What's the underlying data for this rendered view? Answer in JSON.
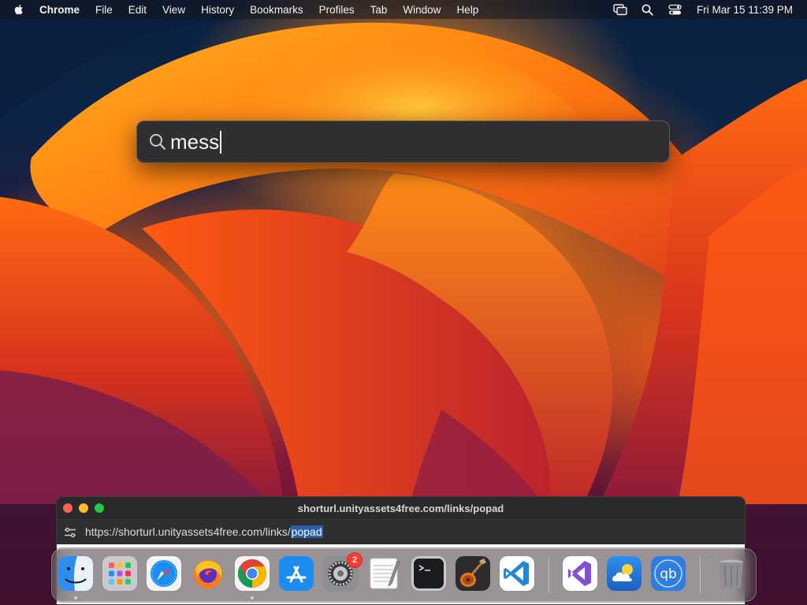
{
  "menubar": {
    "apple_icon": "apple-logo-icon",
    "app_name": "Chrome",
    "items": [
      "File",
      "Edit",
      "View",
      "History",
      "Bookmarks",
      "Profiles",
      "Tab",
      "Window",
      "Help"
    ],
    "status_icons": [
      "window-mirroring-icon",
      "search-icon",
      "control-center-icon"
    ],
    "clock": "Fri Mar 15  11:39 PM"
  },
  "spotlight": {
    "query": "mess",
    "icon": "search-icon"
  },
  "popup_window": {
    "title": "shorturl.unityassets4free.com/links/popad",
    "url_prefix": "https://shorturl.unityassets4free.com/links/",
    "url_selected": "popad"
  },
  "dock": {
    "apps": [
      {
        "name": "Finder",
        "icon": "finder-icon",
        "running": true
      },
      {
        "name": "Launchpad",
        "icon": "launchpad-icon",
        "running": false
      },
      {
        "name": "Safari",
        "icon": "safari-icon",
        "running": false
      },
      {
        "name": "Firefox",
        "icon": "firefox-icon",
        "running": false
      },
      {
        "name": "Google Chrome",
        "icon": "chrome-icon",
        "running": true
      },
      {
        "name": "App Store",
        "icon": "app-store-icon",
        "running": false
      },
      {
        "name": "System Settings",
        "icon": "settings-gear-icon",
        "running": false,
        "badge": "2"
      },
      {
        "name": "TextEdit",
        "icon": "textedit-icon",
        "running": false
      },
      {
        "name": "Terminal",
        "icon": "terminal-icon",
        "running": false
      },
      {
        "name": "GarageBand",
        "icon": "garageband-icon",
        "running": false
      },
      {
        "name": "Visual Studio Code",
        "icon": "vscode-icon",
        "running": false
      },
      {
        "name": "Visual Studio",
        "icon": "visual-studio-icon",
        "running": false
      },
      {
        "name": "Weather",
        "icon": "weather-icon",
        "running": false
      },
      {
        "name": "qBittorrent",
        "icon": "qbittorrent-icon",
        "running": false
      },
      {
        "name": "Trash",
        "icon": "trash-icon",
        "running": false
      }
    ]
  },
  "colors": {
    "close": "#fe5f57",
    "minimize": "#febc2e",
    "maximize": "#28c840",
    "badge": "#ff3b30",
    "selection": "#2d5fa8"
  }
}
